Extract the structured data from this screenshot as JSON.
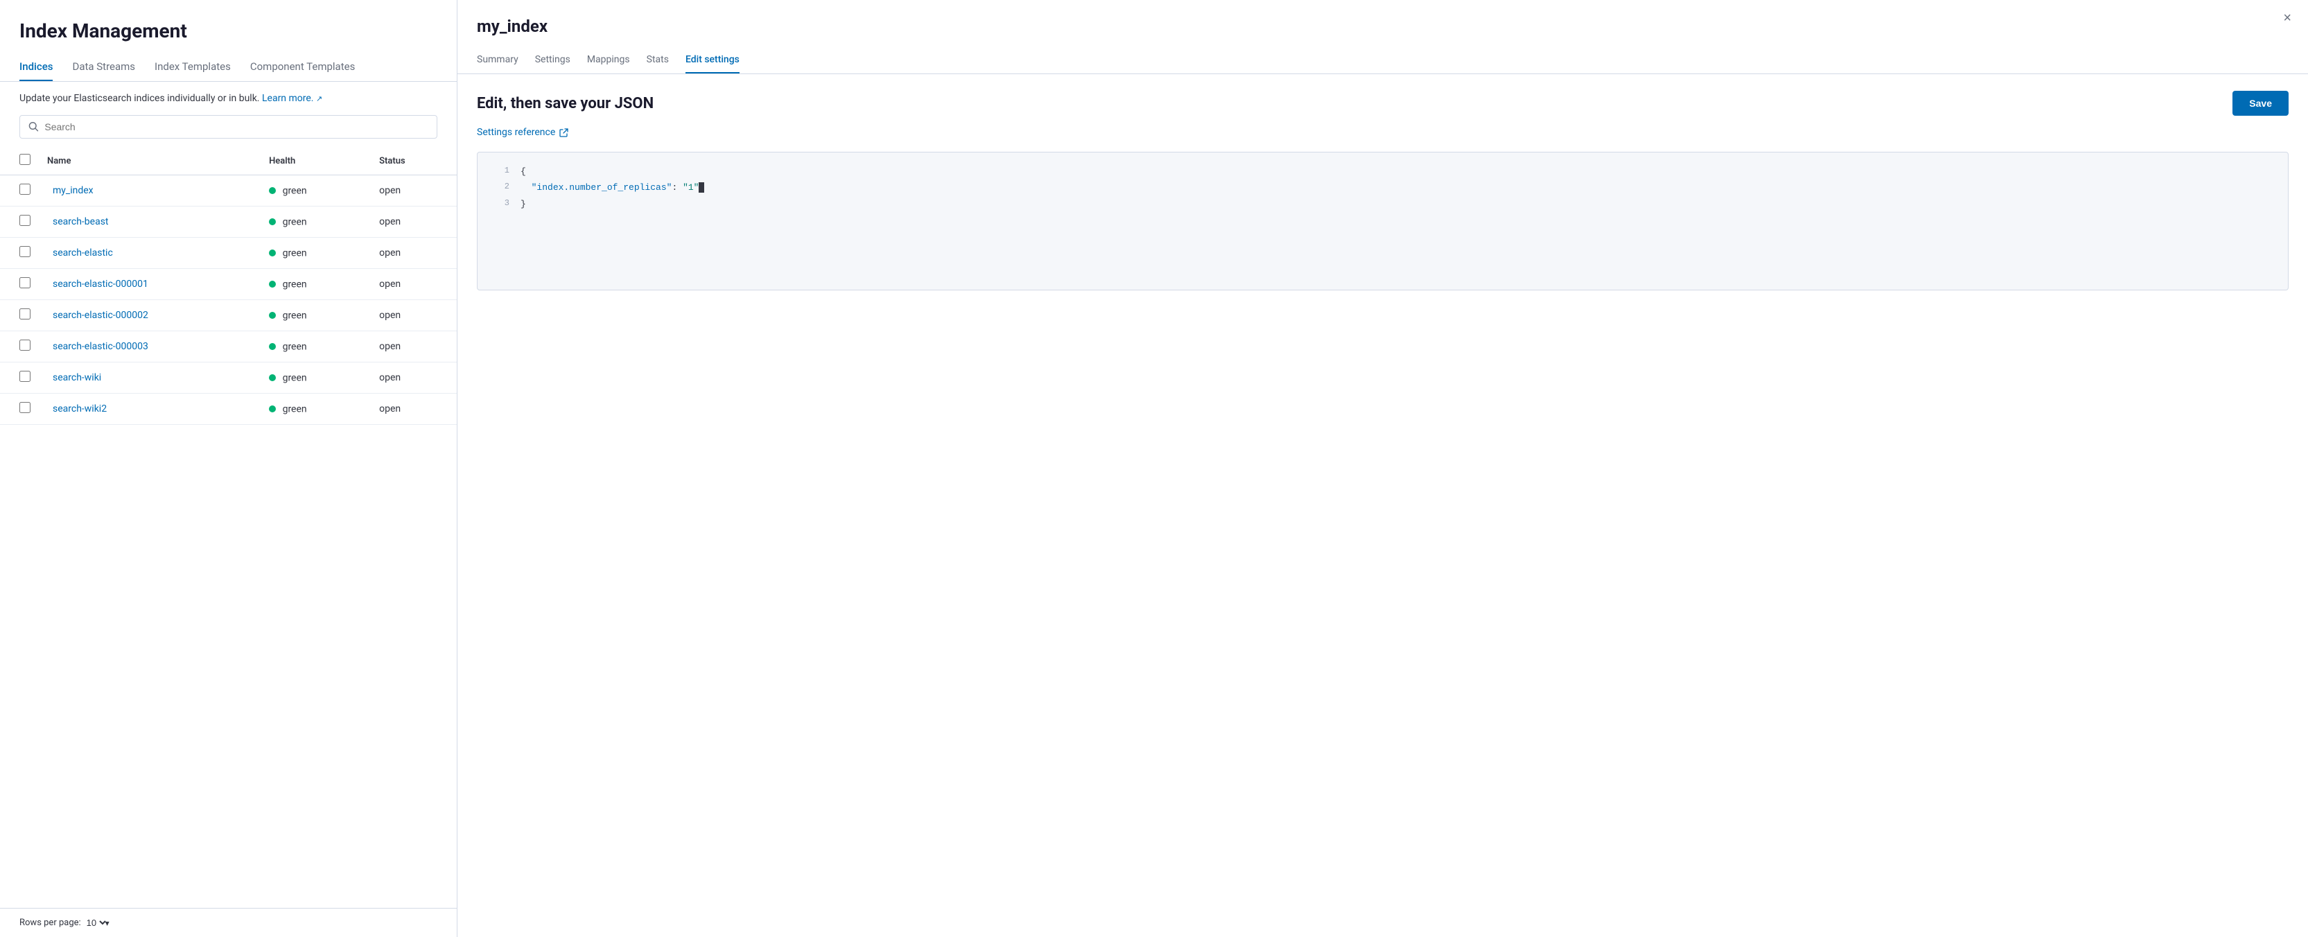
{
  "app": {
    "title": "Index Management"
  },
  "nav": {
    "tabs": [
      {
        "id": "indices",
        "label": "Indices",
        "active": true
      },
      {
        "id": "data-streams",
        "label": "Data Streams",
        "active": false
      },
      {
        "id": "index-templates",
        "label": "Index Templates",
        "active": false
      },
      {
        "id": "component-templates",
        "label": "Component Templates",
        "active": false
      }
    ]
  },
  "description": {
    "text": "Update your Elasticsearch indices individually or in bulk.",
    "link_text": "Learn more.",
    "link_url": "#"
  },
  "search": {
    "placeholder": "Search"
  },
  "table": {
    "columns": [
      "Name",
      "Health",
      "Status"
    ],
    "rows": [
      {
        "name": "my_index",
        "health": "green",
        "status": "open"
      },
      {
        "name": "search-beast",
        "health": "green",
        "status": "open"
      },
      {
        "name": "search-elastic",
        "health": "green",
        "status": "open"
      },
      {
        "name": "search-elastic-000001",
        "health": "green",
        "status": "open"
      },
      {
        "name": "search-elastic-000002",
        "health": "green",
        "status": "open"
      },
      {
        "name": "search-elastic-000003",
        "health": "green",
        "status": "open"
      },
      {
        "name": "search-wiki",
        "health": "green",
        "status": "open"
      },
      {
        "name": "search-wiki2",
        "health": "green",
        "status": "open"
      }
    ]
  },
  "footer": {
    "rows_per_page_label": "Rows per page:",
    "rows_per_page_value": "10"
  },
  "flyout": {
    "title": "my_index",
    "close_label": "×",
    "tabs": [
      {
        "id": "summary",
        "label": "Summary",
        "active": false
      },
      {
        "id": "settings",
        "label": "Settings",
        "active": false
      },
      {
        "id": "mappings",
        "label": "Mappings",
        "active": false
      },
      {
        "id": "stats",
        "label": "Stats",
        "active": false
      },
      {
        "id": "edit-settings",
        "label": "Edit settings",
        "active": true
      }
    ],
    "edit": {
      "title": "Edit, then save your JSON",
      "save_label": "Save",
      "settings_ref_label": "Settings reference",
      "code_lines": [
        {
          "num": "1",
          "content": "{",
          "type": "brace"
        },
        {
          "num": "2",
          "content": "  \"index.number_of_replicas\": \"1\"",
          "type": "key-value"
        },
        {
          "num": "3",
          "content": "}",
          "type": "brace"
        }
      ]
    }
  }
}
